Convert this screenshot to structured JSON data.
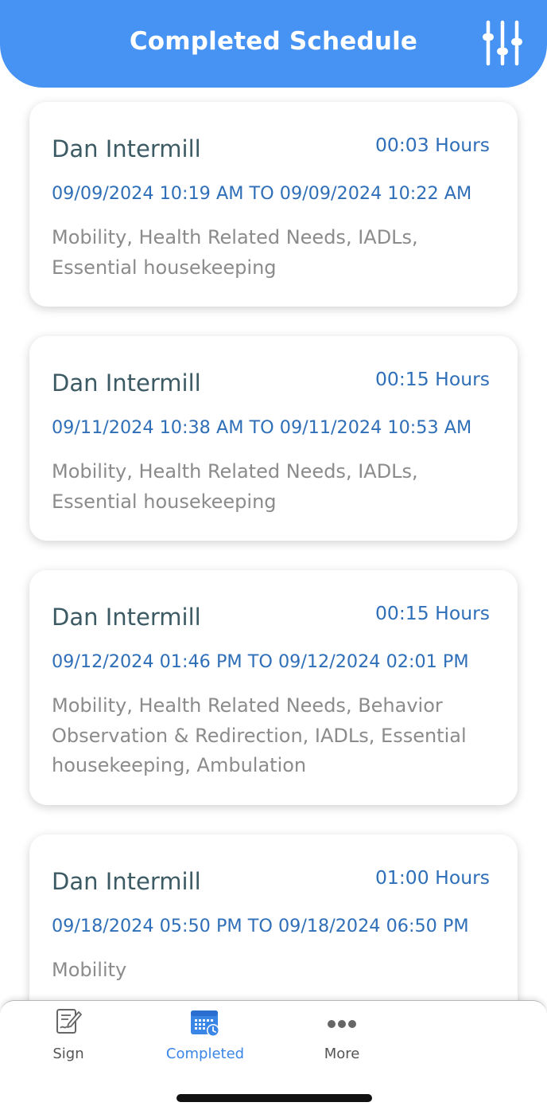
{
  "header": {
    "title": "Completed Schedule",
    "filter_icon": "sliders-icon"
  },
  "schedules": [
    {
      "name": "Dan Intermill",
      "hours": "00:03 Hours",
      "range": "09/09/2024 10:19 AM TO 09/09/2024 10:22 AM",
      "services": "Mobility, Health Related Needs, IADLs, Essential housekeeping"
    },
    {
      "name": "Dan Intermill",
      "hours": "00:15 Hours",
      "range": "09/11/2024 10:38 AM TO 09/11/2024 10:53 AM",
      "services": "Mobility, Health Related Needs, IADLs, Essential housekeeping"
    },
    {
      "name": "Dan Intermill",
      "hours": "00:15 Hours",
      "range": "09/12/2024 01:46 PM TO 09/12/2024 02:01 PM",
      "services": "Mobility, Health Related Needs, Behavior Observation & Redirection, IADLs, Essential housekeeping, Ambulation"
    },
    {
      "name": "Dan Intermill",
      "hours": "01:00 Hours",
      "range": "09/18/2024 05:50 PM TO 09/18/2024 06:50 PM",
      "services": "Mobility"
    }
  ],
  "tabs": [
    {
      "label": "Sign",
      "icon": "sign-document-icon",
      "active": false
    },
    {
      "label": "Completed",
      "icon": "calendar-clock-icon",
      "active": true
    },
    {
      "label": "More",
      "icon": "more-dots-icon",
      "active": false
    }
  ],
  "colors": {
    "header_bg": "#4693f3",
    "accent_blue": "#2f6fb8",
    "name_text": "#3b5a63",
    "services_text": "#8b8b8b",
    "active_tab": "#3a86e6"
  }
}
